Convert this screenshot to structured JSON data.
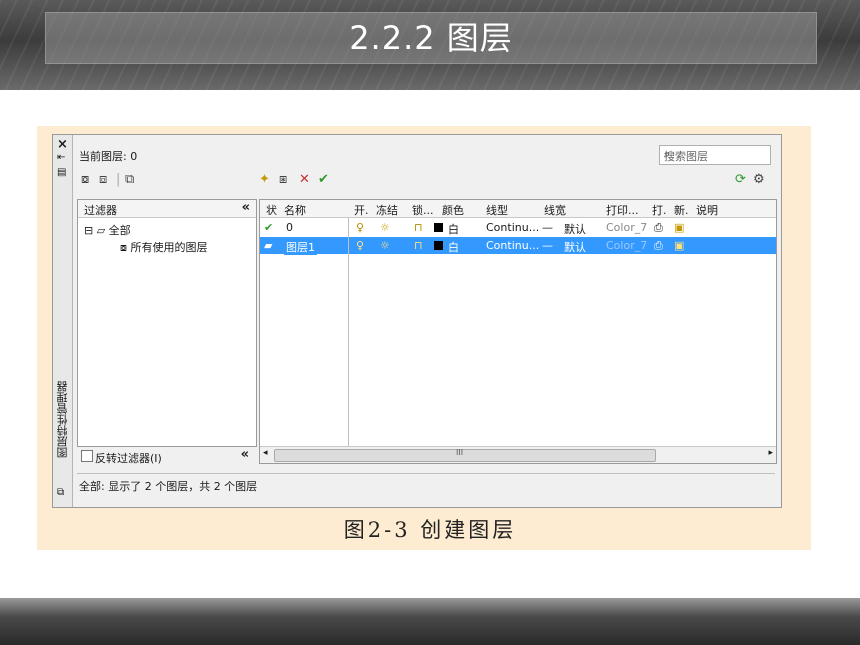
{
  "slide": {
    "title": "2.2.2  图层",
    "caption": "图2-3  创建图层"
  },
  "dialog": {
    "side_title": "图层特性管理器",
    "current_layer": "当前图层: 0",
    "search_placeholder": "搜索图层",
    "filter_header": "过滤器",
    "tree": {
      "root": "全部",
      "child": "所有使用的图层"
    },
    "invert_filter": "反转过滤器(I)",
    "columns": [
      "状",
      "名称",
      "开.",
      "冻结",
      "锁...",
      "颜色",
      "线型",
      "线宽",
      "打印...",
      "打.",
      "新.",
      "说明"
    ],
    "rows": [
      {
        "status": "✔",
        "name": "0",
        "color_name": "白",
        "linetype": "Continu...",
        "lineweight": "默认",
        "plot_style": "Color_7",
        "selected": false
      },
      {
        "status": "▰",
        "name": "图层1",
        "color_name": "白",
        "linetype": "Continu...",
        "lineweight": "默认",
        "plot_style": "Color_7",
        "selected": true
      }
    ],
    "scroll_grip": "III",
    "status_bar": "全部: 显示了 2 个图层，共 2 个图层"
  },
  "colors": {
    "selection": "#3399ff",
    "figure_background": "#fdecd2",
    "check_green": "#2e9a2e"
  }
}
